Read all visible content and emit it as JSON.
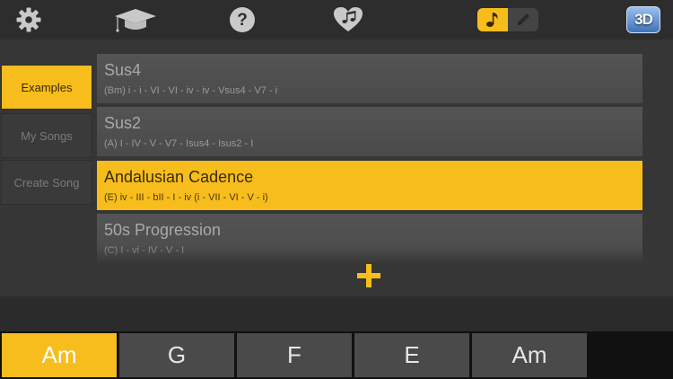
{
  "toolbar": {
    "icons": [
      "gear-icon",
      "graduation-cap-icon",
      "help-icon",
      "heart-music-icon"
    ],
    "mode_toggle": [
      "music-note-icon",
      "pencil-icon"
    ],
    "view_3d_label": "3D"
  },
  "sidebar": {
    "items": [
      {
        "label": "Examples",
        "active": true
      },
      {
        "label": "My Songs",
        "active": false
      },
      {
        "label": "Create Song",
        "active": false
      }
    ]
  },
  "songs": [
    {
      "title": "Sus4",
      "progression": "(Bm) i - i - VI - VI - iv - iv - Vsus4 - V7 - i",
      "active": false
    },
    {
      "title": "Sus2",
      "progression": "(A) I - IV - V - V7 - Isus4 - Isus2 - I",
      "active": false
    },
    {
      "title": "Andalusian Cadence",
      "progression": "(E)  iv - III - bII - I - iv (i - VII - VI - V - i)",
      "active": true
    },
    {
      "title": "50s Progression",
      "progression": "(C)  I - vi - IV - V - I",
      "active": false
    }
  ],
  "add_icon": "plus-icon",
  "chords": [
    {
      "label": "Am",
      "active": true
    },
    {
      "label": "G",
      "active": false
    },
    {
      "label": "F",
      "active": false
    },
    {
      "label": "E",
      "active": false
    },
    {
      "label": "Am",
      "active": false
    }
  ],
  "colors": {
    "accent": "#f7bd1c",
    "background": "#2b2b2b",
    "panel": "#363636",
    "row": "#4e4e4e",
    "chord_tile": "#4a4a4a"
  }
}
